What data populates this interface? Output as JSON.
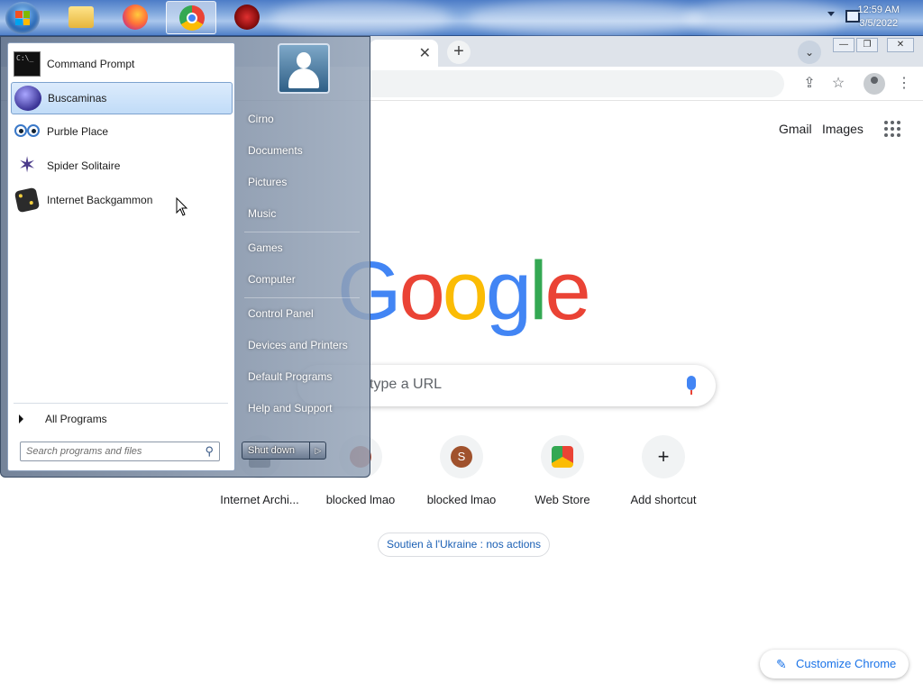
{
  "taskbar": {
    "apps": [
      {
        "name": "file-explorer"
      },
      {
        "name": "firefox"
      },
      {
        "name": "chrome",
        "active": true
      },
      {
        "name": "red-app"
      }
    ],
    "clock": {
      "time": "12:59 AM",
      "date": "3/5/2022"
    }
  },
  "chrome": {
    "tab_close": "✕",
    "new_tab": "+",
    "header_links": {
      "gmail": "Gmail",
      "images": "Images"
    },
    "logo": "Google",
    "search_placeholder": "type a URL",
    "shortcuts": [
      {
        "label": "Internet Archi...",
        "initial": "",
        "color": "#5f6368"
      },
      {
        "label": "blocked lmao",
        "initial": "",
        "color": "#c0563b"
      },
      {
        "label": "blocked lmao",
        "initial": "S",
        "color": "#a0522d"
      },
      {
        "label": "Web Store",
        "initial": "",
        "color": "#34a853"
      },
      {
        "label": "Add shortcut",
        "initial": "+",
        "color": "#202124"
      }
    ],
    "ukraine_chip": "Soutien à l'Ukraine : nos actions",
    "customize_label": "Customize Chrome"
  },
  "start_menu": {
    "programs": [
      {
        "label": "Command Prompt",
        "icon": "cmd-icon"
      },
      {
        "label": "Buscaminas",
        "icon": "minesweeper-icon",
        "highlighted": true
      },
      {
        "label": "Purble Place",
        "icon": "purble-icon"
      },
      {
        "label": "Spider Solitaire",
        "icon": "spider-icon"
      },
      {
        "label": "Internet Backgammon",
        "icon": "backgammon-icon"
      }
    ],
    "all_programs": "All Programs",
    "search_placeholder": "Search programs and files",
    "right": {
      "user": "Cirno",
      "documents": "Documents",
      "pictures": "Pictures",
      "music": "Music",
      "games": "Games",
      "computer": "Computer",
      "control_panel": "Control Panel",
      "devices": "Devices and Printers",
      "default_programs": "Default Programs",
      "help": "Help and Support"
    },
    "shutdown": "Shut down"
  }
}
